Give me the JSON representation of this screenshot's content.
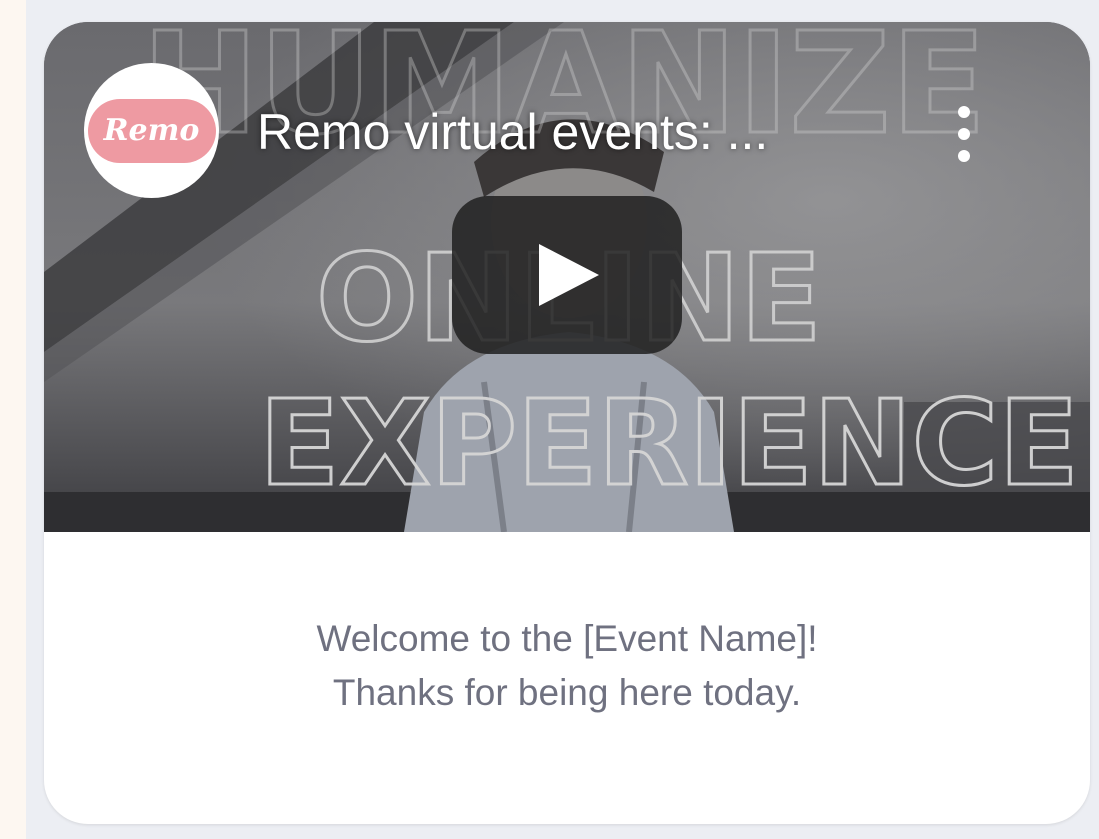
{
  "video": {
    "channel_avatar_text": "Remo",
    "title": "Remo virtual events: ...",
    "overlay_words": [
      "HUMANIZE",
      "ONLINE",
      "EXPERIENCE"
    ],
    "icons": {
      "more": "more-vert-icon",
      "play": "play-icon"
    }
  },
  "caption": {
    "line1": "Welcome to the [Event Name]!",
    "line2": "Thanks for being here today."
  },
  "colors": {
    "page_background": "#fdf7f1",
    "panel_background": "#eceef3",
    "card_background": "#ffffff",
    "avatar_pink": "#ee9aa2",
    "caption_text": "#6f7180",
    "play_button": "#212121"
  }
}
